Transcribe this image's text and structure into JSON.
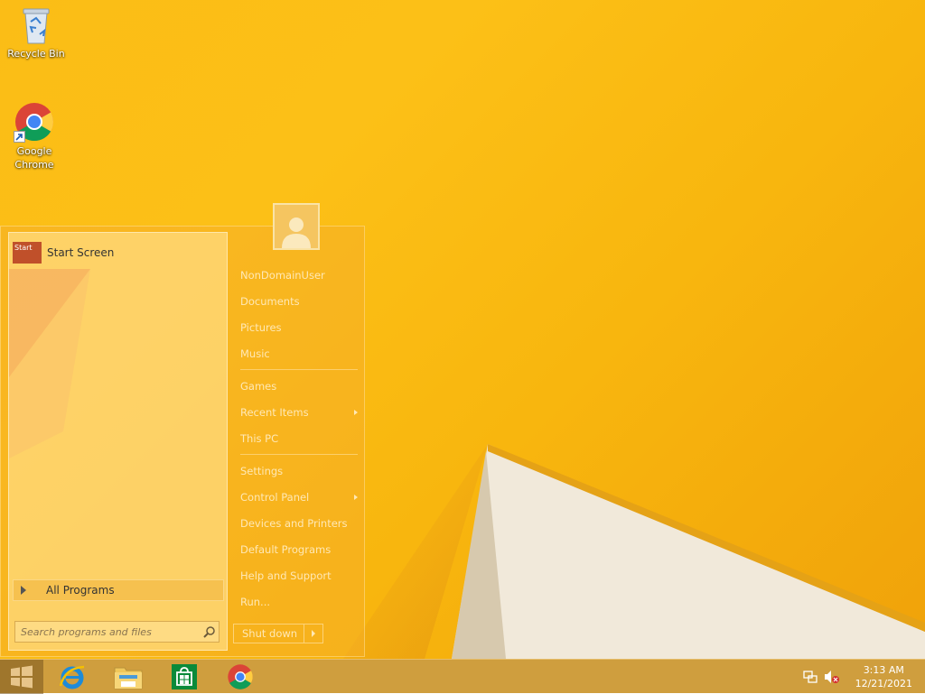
{
  "desktop": {
    "icons": [
      {
        "name": "recycle-bin",
        "label": "Recycle Bin"
      },
      {
        "name": "google-chrome",
        "label_line1": "Google",
        "label_line2": "Chrome"
      }
    ]
  },
  "start_menu": {
    "pinned": {
      "tile_text": "Start",
      "label": "Start Screen"
    },
    "all_programs": "All Programs",
    "search_placeholder": "Search programs and files",
    "user": "NonDomainUser",
    "items": {
      "documents": "Documents",
      "pictures": "Pictures",
      "music": "Music",
      "games": "Games",
      "recent_items": "Recent Items",
      "this_pc": "This PC",
      "settings": "Settings",
      "control_panel": "Control Panel",
      "devices_printers": "Devices and Printers",
      "default_programs": "Default Programs",
      "help_support": "Help and Support",
      "run": "Run..."
    },
    "shutdown": "Shut down"
  },
  "taskbar": {
    "pinned_apps": [
      "start-icon",
      "internet-explorer-icon",
      "file-explorer-icon",
      "store-icon",
      "chrome-icon"
    ],
    "clock": {
      "time": "3:13 AM",
      "date": "12/21/2021"
    }
  },
  "colors": {
    "wallpaper": "#fbbd16",
    "taskbar": "#c8911f",
    "start_tile": "#c0502a"
  }
}
